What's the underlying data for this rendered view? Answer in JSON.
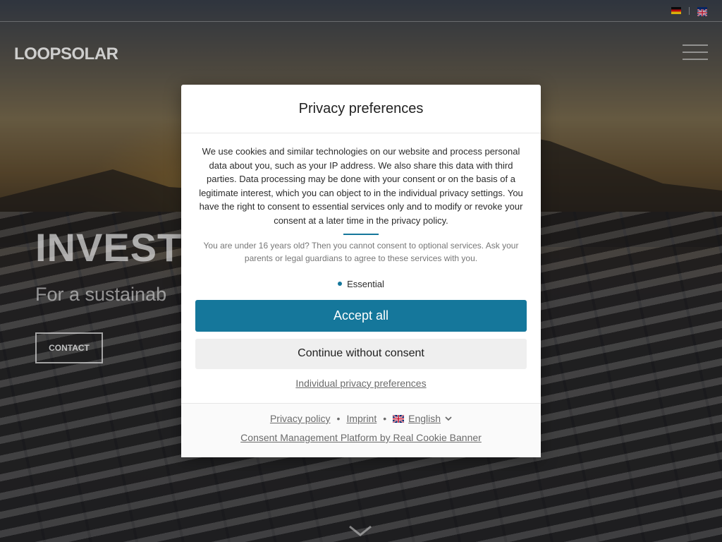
{
  "topbar": {
    "flags": [
      {
        "icon": "german-flag-icon",
        "label": "DE"
      },
      {
        "icon": "english-flag-icon",
        "label": "EN"
      }
    ]
  },
  "header": {
    "logo": "LOOPSOLAR",
    "menu_icon": "hamburger-menu-icon"
  },
  "hero": {
    "title": "INVEST",
    "subtitle": "For a sustainab",
    "contact_label": "CONTACT",
    "scroll_icon": "chevron-down-icon"
  },
  "dialog": {
    "title": "Privacy preferences",
    "description": "We use cookies and similar technologies on our website and process personal data about you, such as your IP address. We also share this data with third parties. Data processing may be done with your consent or on the basis of a legitimate interest, which you can object to in the individual privacy settings. You have the right to consent to essential services only and to modify or revoke your consent at a later time in the privacy policy.",
    "age_note": "You are under 16 years old? Then you cannot consent to optional services. Ask your parents or legal guardians to agree to these services with you.",
    "groups": [
      "Essential"
    ],
    "accept_all": "Accept all",
    "continue_without": "Continue without consent",
    "individual": "Individual privacy preferences",
    "footer": {
      "privacy_policy": "Privacy policy",
      "imprint": "Imprint",
      "language": "English",
      "separator": "•",
      "powered_by": "Consent Management Platform by Real Cookie Banner"
    }
  },
  "colors": {
    "accent": "#15779b",
    "secondary_button": "#efefef",
    "footer_text": "#6b6b6b"
  }
}
